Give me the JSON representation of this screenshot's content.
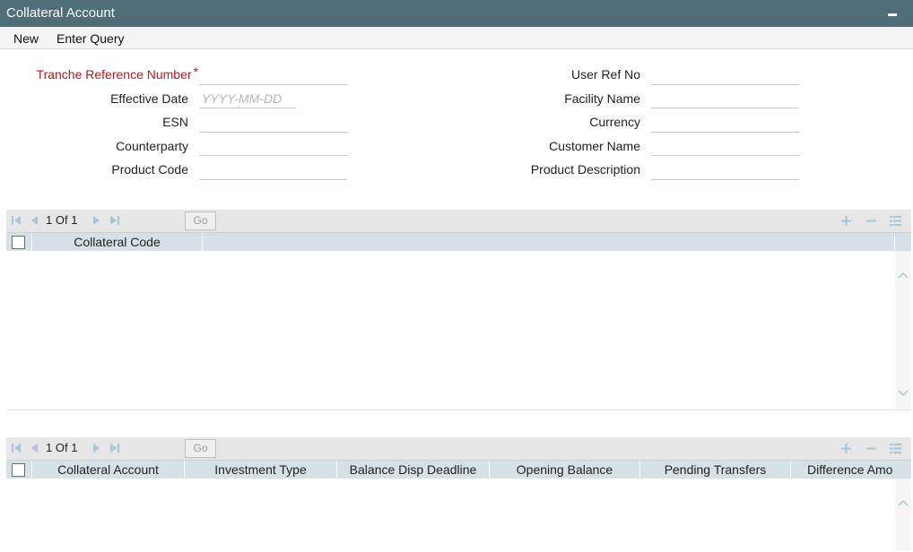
{
  "window": {
    "title": "Collateral Account"
  },
  "menu": {
    "new_label": "New",
    "enter_query_label": "Enter Query"
  },
  "form": {
    "tranche_ref_label": "Tranche Reference Number",
    "required_marker": "*",
    "effective_date_label": "Effective Date",
    "effective_date_placeholder": "YYYY-MM-DD",
    "esn_label": "ESN",
    "counterparty_label": "Counterparty",
    "product_code_label": "Product Code",
    "user_ref_label": "User Ref No",
    "facility_name_label": "Facility Name",
    "currency_label": "Currency",
    "customer_name_label": "Customer Name",
    "product_description_label": "Product Description"
  },
  "grid1": {
    "page_current": "1",
    "page_of": "Of",
    "page_total": "1",
    "go_label": "Go",
    "columns": [
      "Collateral Code"
    ]
  },
  "grid2": {
    "page_current": "1",
    "page_of": "Of",
    "page_total": "1",
    "go_label": "Go",
    "columns": [
      "Collateral Account",
      "Investment Type",
      "Balance Disp Deadline",
      "Opening Balance",
      "Pending Transfers",
      "Difference Amo"
    ]
  },
  "icons": {
    "first": "first-page-icon",
    "prev": "prev-page-icon",
    "next": "next-page-icon",
    "last": "last-page-icon",
    "add": "add-row-icon",
    "delete": "delete-row-icon",
    "settings": "column-settings-icon"
  },
  "colors": {
    "titlebar": "#4f6e79",
    "required": "#c0161c",
    "grid_header": "#d5e1e6",
    "nav_icon": "#a7c6d6"
  }
}
